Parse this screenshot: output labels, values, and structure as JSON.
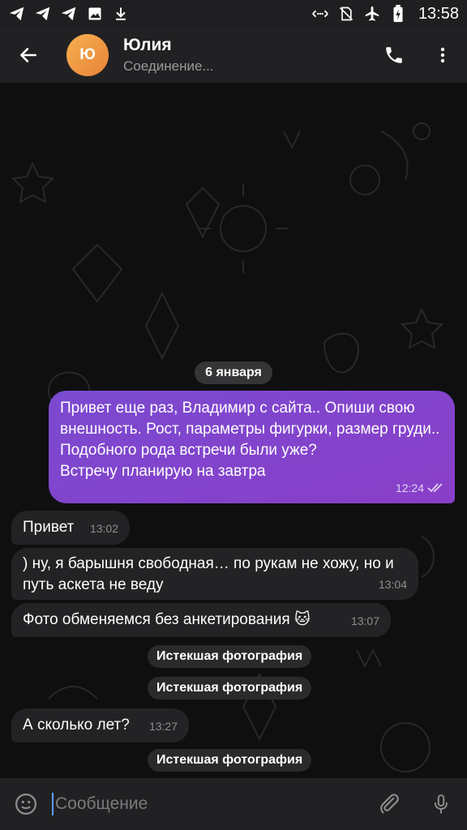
{
  "status_bar": {
    "time": "13:58",
    "left_icons": [
      "telegram-icon",
      "telegram-icon",
      "telegram-icon",
      "image-icon",
      "download-icon"
    ],
    "right_icons": [
      "link-icon",
      "no-sim-icon",
      "airplane-icon",
      "battery-charging-icon"
    ]
  },
  "header": {
    "avatar_initial": "Ю",
    "avatar_color": "#f0a04a",
    "name": "Юлия",
    "status": "Соединение..."
  },
  "chat": {
    "date_label": "6 января",
    "messages": [
      {
        "direction": "out",
        "text": "Привет еще раз, Владимир с сайта.. Опиши свою внешность. Рост, параметры фигурки, размер груди..\nПодобного рода встречи были уже?\nВстречу планирую на завтра",
        "time": "12:24",
        "read": true
      },
      {
        "direction": "in",
        "text": "Привет",
        "time": "13:02"
      },
      {
        "direction": "in",
        "text": ") ну, я барышня свободная… по рукам не хожу, но и путь аскета не веду",
        "time": "13:04"
      },
      {
        "direction": "in",
        "text": "Фото обменяемся без анкетирования 🐱",
        "time": "13:07"
      },
      {
        "direction": "in",
        "text": "А сколько лет?",
        "time": "13:27"
      }
    ],
    "system": [
      "Истекшая фотография",
      "Истекшая фотография",
      "Истекшая фотография"
    ],
    "accent_out": "#7b45cf"
  },
  "composer": {
    "placeholder": "Сообщение"
  }
}
